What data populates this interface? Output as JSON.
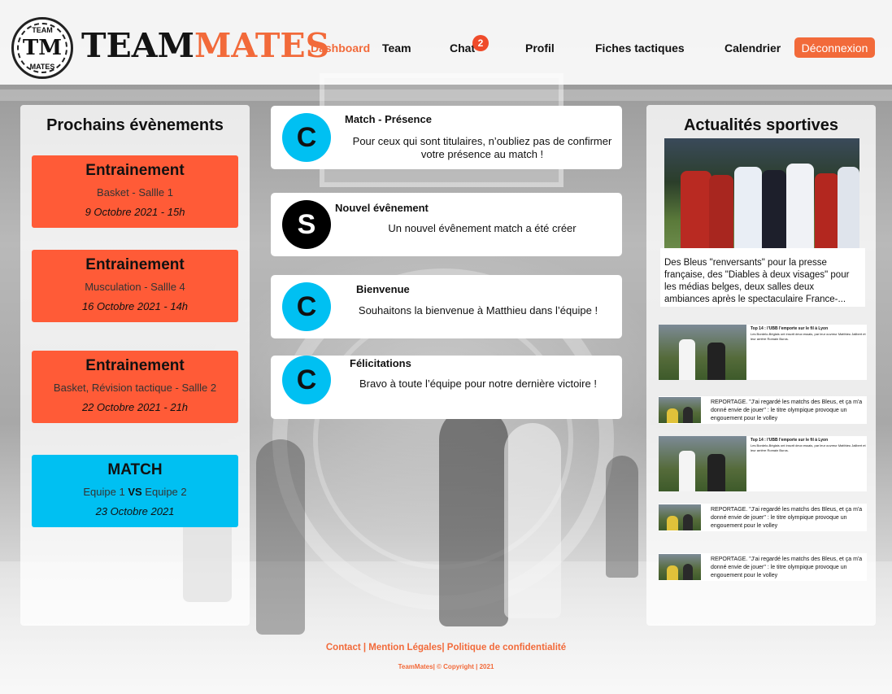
{
  "brand": {
    "badge_top": "TEAM",
    "badge_mono": "TM",
    "badge_bottom": "MATES",
    "word_team": "TEAM",
    "word_mates": "MATES",
    "accent_color": "#f26a3a"
  },
  "nav": {
    "dashboard": "Dashboard",
    "team": "Team",
    "chat": "Chat",
    "chat_badge": "2",
    "profil": "Profil",
    "fiches": "Fiches tactiques",
    "calendrier": "Calendrier",
    "logout": "Déconnexion"
  },
  "events_panel": {
    "title": "Prochains évènements",
    "events": [
      {
        "title": "Entrainement",
        "sub": "Basket - Sallle 1",
        "date": "9 Octobre 2021 - 15h",
        "color": "#ff5b37"
      },
      {
        "title": "Entrainement",
        "sub": "Musculation - Sallle 4",
        "date": "16 Octobre 2021 - 14h",
        "color": "#ff5b37"
      },
      {
        "title": "Entrainement",
        "sub": "Basket, Révision tactique - Sallle 2",
        "date": "22 Octobre 2021 - 21h",
        "color": "#ff5b37"
      },
      {
        "title": "MATCH",
        "sub_a": "Equipe 1",
        "sub_vs": "VS",
        "sub_b": "Equipe 2",
        "date": "23 Octobre 2021",
        "color": "#00c0f2"
      }
    ]
  },
  "notifications": [
    {
      "avatar": "C",
      "title": "Match - Présence",
      "body": "Pour ceux qui sont titulaires, n’oubliez pas de confirmer votre présence au match !"
    },
    {
      "avatar": "S",
      "title": "Nouvel évênement",
      "body": "Un nouvel évênement match a été créer"
    },
    {
      "avatar": "C",
      "title": "Bienvenue",
      "body": "Souhaitons la bienvenue à Matthieu dans l’équipe !"
    },
    {
      "avatar": "C",
      "title": "Félicitations",
      "body": "Bravo à toute l’équipe pour notre dernière victoire !"
    }
  ],
  "news_panel": {
    "title": "Actualités sportives",
    "main_headline": "Des Bleus \"renversants\" pour la presse française, des \"Diables à deux visages\" pour les médias belges, deux salles deux ambiances après le spectaculaire France-...",
    "items": [
      {
        "title": "Top 14 : l'UBB l'emporte sur le fil à Lyon",
        "body": "Les Bordelo-Béglais ont inscrit deux essais, par leur ouvreur Matthieu Jalibert et leur arrière Romain Buros."
      },
      {
        "body": "REPORTAGE. \"J'ai regardé les matchs des Bleus, et ça m'a donné envie de jouer\" : le titre olympique provoque un engouement pour le volley"
      },
      {
        "title": "Top 14 : l'UBB l'emporte sur le fil à Lyon",
        "body": "Les Bordelo-Béglais ont inscrit deux essais, par leur ouvreur Matthieu Jalibert et leur arrière Romain Buros."
      },
      {
        "body": "REPORTAGE. \"J'ai regardé les matchs des Bleus, et ça m'a donné envie de jouer\" : le titre olympique provoque un engouement pour le volley"
      },
      {
        "body": "REPORTAGE. \"J'ai regardé les matchs des Bleus, et ça m'a donné envie de jouer\" : le titre olympique provoque un engouement pour le volley"
      }
    ]
  },
  "footer": {
    "links": "Contact | Mention Légales| Politique de confidentialité",
    "copyright": "TeamMates| © Copyright | 2021"
  }
}
